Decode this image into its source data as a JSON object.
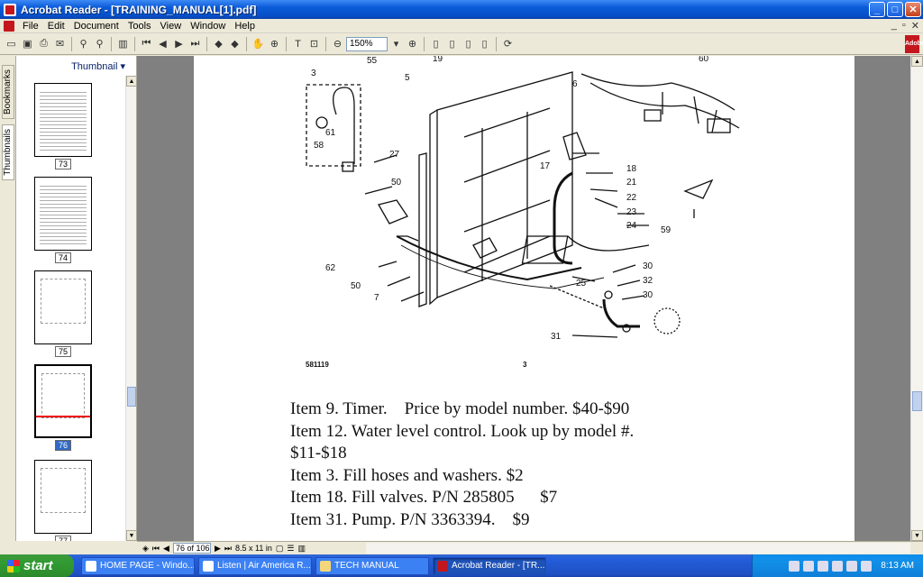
{
  "window": {
    "title": "Acrobat Reader - [TRAINING_MANUAL[1].pdf]",
    "minimize": "_",
    "maximize": "□",
    "close": "✕"
  },
  "menu": [
    "File",
    "Edit",
    "Document",
    "Tools",
    "View",
    "Window",
    "Help"
  ],
  "toolbar": {
    "zoom_value": "150%"
  },
  "side_tabs": [
    "Bookmarks",
    "Thumbnails"
  ],
  "thumbnail_pane": {
    "header": "Thumbnail ▾",
    "pages": [
      "73",
      "74",
      "75",
      "76",
      "77"
    ],
    "selected": "76"
  },
  "document": {
    "diagram_labels": [
      "3",
      "55",
      "19",
      "5",
      "6",
      "60",
      "61",
      "58",
      "27",
      "50",
      "17",
      "18",
      "21",
      "22",
      "23",
      "24",
      "59",
      "62",
      "50",
      "7",
      "25",
      "30",
      "32",
      "30",
      "31",
      "581119",
      "3"
    ],
    "text_lines": [
      "Item 9. Timer.    Price by model number. $40-$90",
      "Item 12. Water level control. Look up by model #.",
      "$11-$18",
      "Item 3. Fill hoses and washers. $2",
      "Item 18. Fill valves. P/N 285805      $7",
      "Item 31. Pump. P/N 3363394.    $9"
    ]
  },
  "statusbar": {
    "page": "76 of 106",
    "size": "8.5 x 11 in"
  },
  "taskbar": {
    "start": "start",
    "tasks": [
      "HOME PAGE - Windo...",
      "Listen | Air America R...",
      "TECH MANUAL",
      "Acrobat Reader - [TR..."
    ],
    "clock": "8:13 AM"
  }
}
